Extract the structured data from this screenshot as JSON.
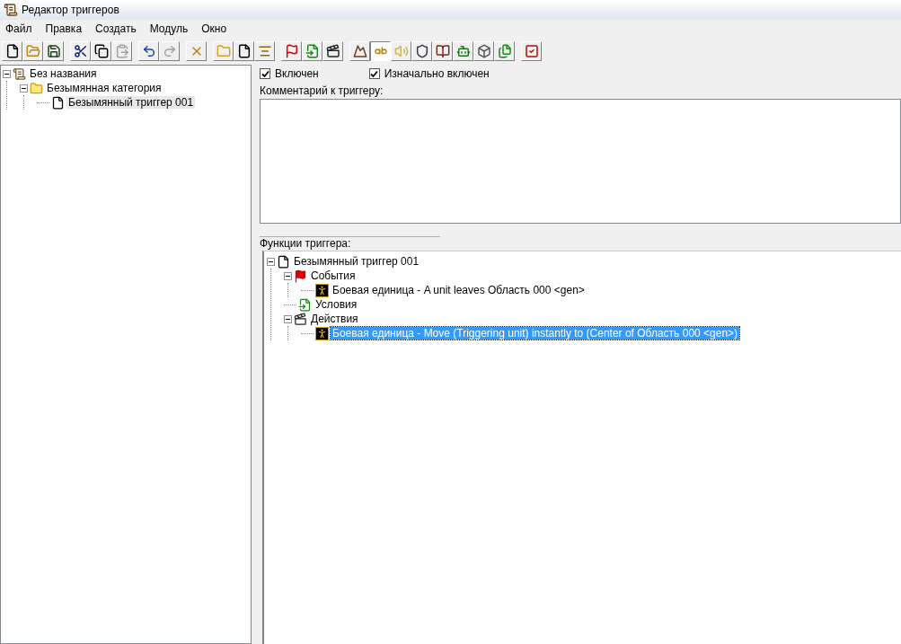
{
  "window": {
    "title": "Редактор триггеров"
  },
  "menu": [
    "Файл",
    "Правка",
    "Создать",
    "Модуль",
    "Окно"
  ],
  "toolbar": [
    [
      {
        "kind": "new",
        "pressed": false,
        "disabled": false
      },
      {
        "kind": "open",
        "pressed": false,
        "disabled": false
      },
      {
        "kind": "save",
        "pressed": false,
        "disabled": false
      }
    ],
    [
      {
        "kind": "cut",
        "pressed": false,
        "disabled": false
      },
      {
        "kind": "copy",
        "pressed": false,
        "disabled": false
      },
      {
        "kind": "paste",
        "pressed": false,
        "disabled": true
      }
    ],
    [
      {
        "kind": "undo",
        "pressed": false,
        "disabled": false
      },
      {
        "kind": "redo",
        "pressed": false,
        "disabled": true
      }
    ],
    [
      {
        "kind": "delete",
        "pressed": false,
        "disabled": false
      }
    ],
    [
      {
        "kind": "category",
        "pressed": false,
        "disabled": false
      },
      {
        "kind": "trigger",
        "pressed": false,
        "disabled": false
      },
      {
        "kind": "comment",
        "pressed": false,
        "disabled": false
      }
    ],
    [
      {
        "kind": "event",
        "pressed": false,
        "disabled": false
      },
      {
        "kind": "condition",
        "pressed": false,
        "disabled": false
      },
      {
        "kind": "action",
        "pressed": false,
        "disabled": false
      }
    ],
    [
      {
        "kind": "terrain",
        "pressed": false,
        "disabled": false
      },
      {
        "kind": "text",
        "pressed": true,
        "disabled": false
      },
      {
        "kind": "sound",
        "pressed": false,
        "disabled": false
      },
      {
        "kind": "unit",
        "pressed": false,
        "disabled": false
      },
      {
        "kind": "book",
        "pressed": false,
        "disabled": false
      },
      {
        "kind": "ai",
        "pressed": false,
        "disabled": false
      },
      {
        "kind": "object",
        "pressed": false,
        "disabled": false
      },
      {
        "kind": "import",
        "pressed": false,
        "disabled": false
      }
    ],
    [
      {
        "kind": "test",
        "pressed": false,
        "disabled": false
      }
    ]
  ],
  "left_tree": [
    {
      "label": "Без названия",
      "kind": "map",
      "selected": false,
      "expanded": true,
      "children": [
        {
          "label": "Безымянная категория",
          "kind": "category",
          "selected": false,
          "expanded": true,
          "children": [
            {
              "label": "Безымянный триггер 001",
              "kind": "trigger",
              "selected": true
            }
          ]
        }
      ]
    }
  ],
  "options": [
    {
      "label": "Включен",
      "checked": true
    },
    {
      "label": "Изначально включен",
      "checked": true
    }
  ],
  "comment": {
    "label": "Комментарий к триггеру:"
  },
  "functions": {
    "label": "Функции триггера:",
    "tree": [
      {
        "label": "Безымянный триггер 001",
        "kind": "trigger",
        "selected": false,
        "expanded": true,
        "children": [
          {
            "label": "События",
            "kind": "events",
            "selected": false,
            "expanded": true,
            "children": [
              {
                "label": "Боевая единица - A unit leaves Область 000 <gen>",
                "kind": "unit",
                "selected": false
              }
            ]
          },
          {
            "label": "Условия",
            "kind": "conditions",
            "selected": false
          },
          {
            "label": "Действия",
            "kind": "actions",
            "selected": false,
            "expanded": true,
            "children": [
              {
                "label": "Боевая единица - Move (Triggering unit) instantly to (Center of Область 000 <gen>)",
                "kind": "unit",
                "selected": true
              }
            ]
          }
        ]
      }
    ]
  }
}
